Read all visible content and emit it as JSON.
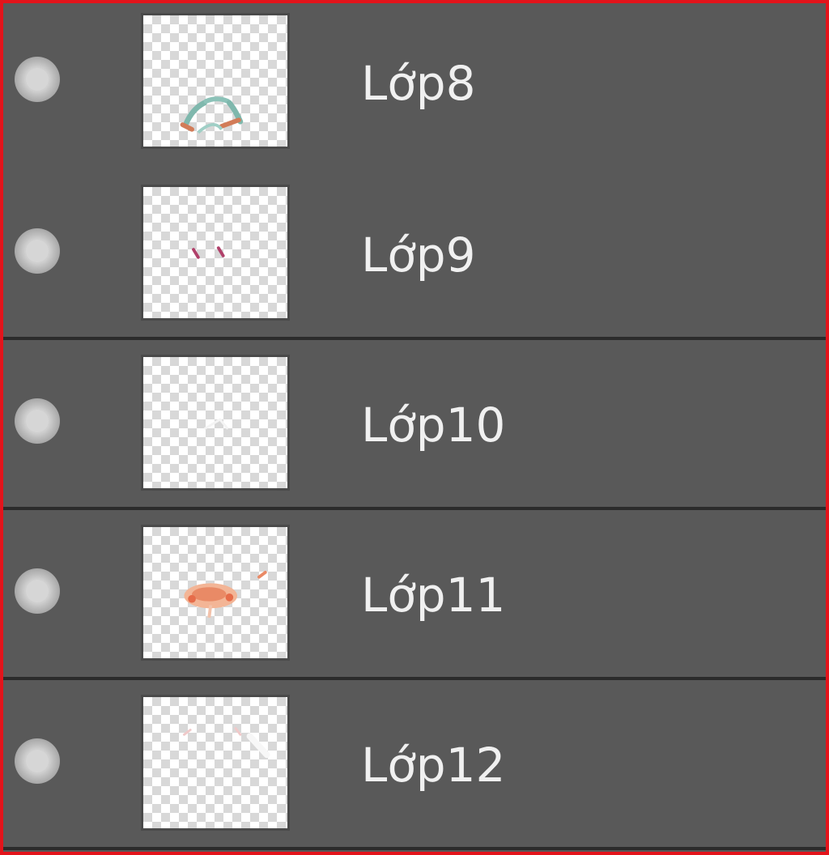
{
  "layers_panel": {
    "layers": [
      {
        "name": "Lớp8",
        "visible": true,
        "thumbnail_icon": "arrow-curve-art"
      },
      {
        "name": "Lớp9",
        "visible": true,
        "thumbnail_icon": "small-marks-art"
      },
      {
        "name": "Lớp10",
        "visible": true,
        "thumbnail_icon": "faint-mark-art"
      },
      {
        "name": "Lớp11",
        "visible": true,
        "thumbnail_icon": "orange-shape-art"
      },
      {
        "name": "Lớp12",
        "visible": true,
        "thumbnail_icon": "light-marks-art"
      }
    ]
  },
  "colors": {
    "panel_background": "#595959",
    "row_divider": "#2b2b2b",
    "frame_border": "#e3141b",
    "text": "#f0f0f0"
  }
}
